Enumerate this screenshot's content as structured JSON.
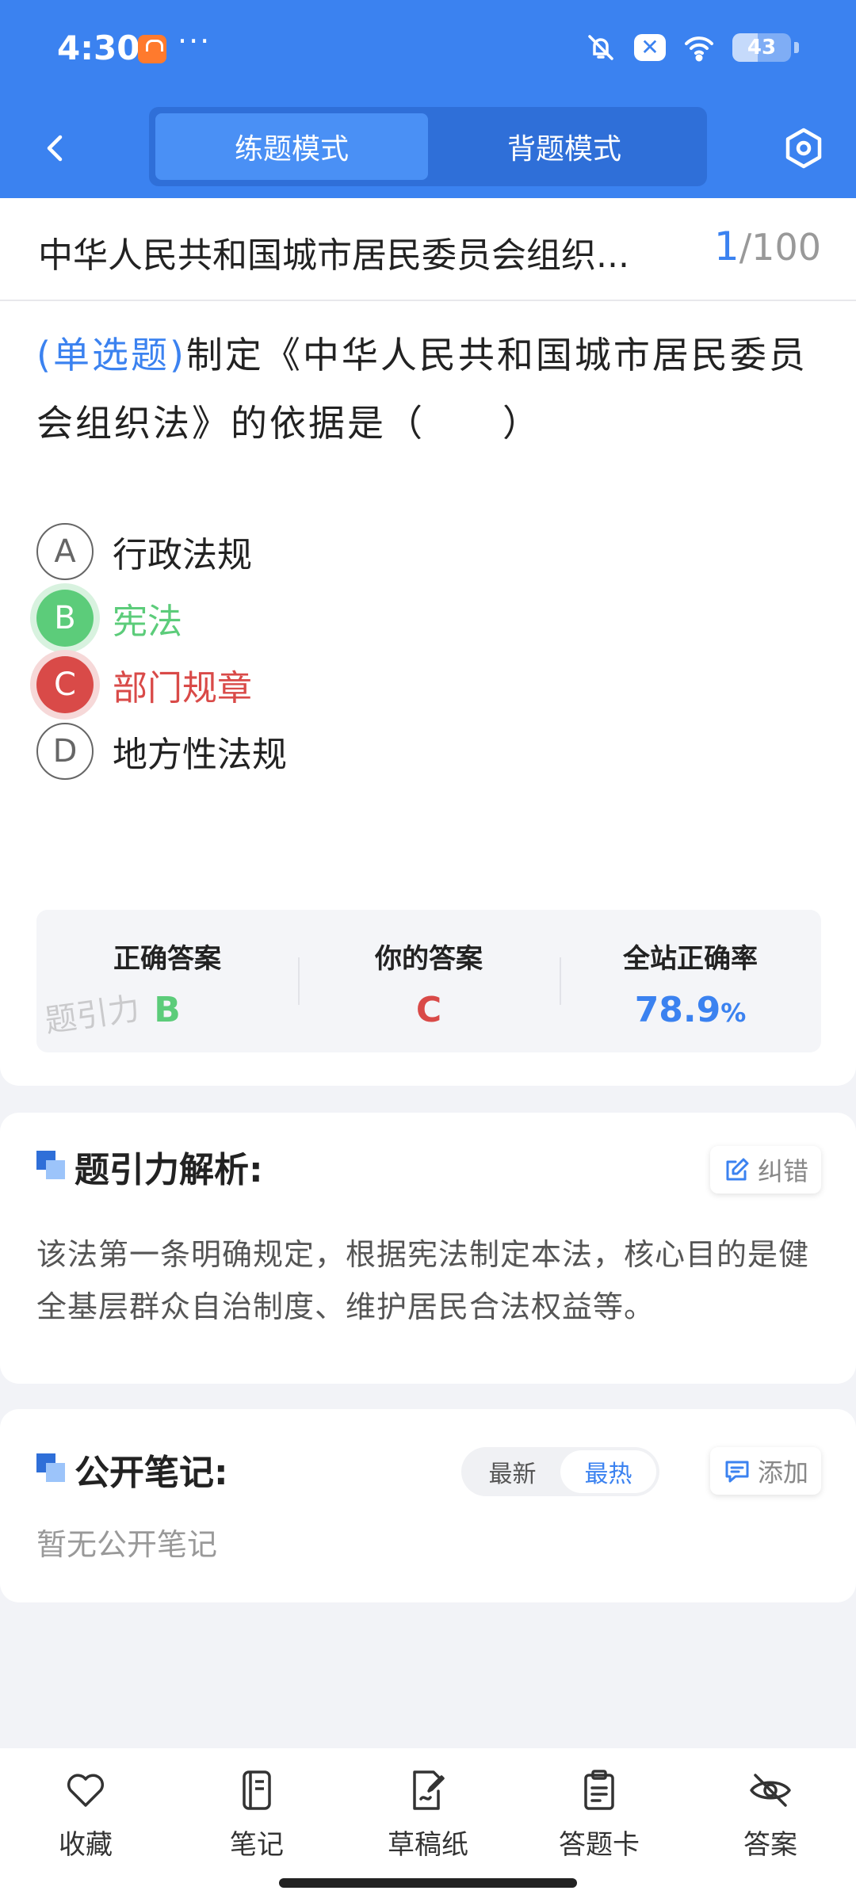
{
  "status_bar": {
    "time": "4:30",
    "dots": "···",
    "battery": "43"
  },
  "nav": {
    "modes": [
      "练题模式",
      "背题模式"
    ],
    "active_mode_index": 0
  },
  "question": {
    "title": "中华人民共和国城市居民委员会组织...",
    "current": "1",
    "total": "/100",
    "type": "(单选题)",
    "stem": "制定《中华人民共和国城市居民委员会组织法》的依据是（　　）",
    "options": [
      {
        "letter": "A",
        "text": "行政法规",
        "state": "normal"
      },
      {
        "letter": "B",
        "text": "宪法",
        "state": "correct"
      },
      {
        "letter": "C",
        "text": "部门规章",
        "state": "wrong"
      },
      {
        "letter": "D",
        "text": "地方性法规",
        "state": "normal"
      }
    ]
  },
  "result": {
    "correct_label": "正确答案",
    "correct_value": "B",
    "yours_label": "你的答案",
    "yours_value": "C",
    "rate_label": "全站正确率",
    "rate_value": "78.9",
    "rate_unit": "%",
    "watermark": "题引力"
  },
  "analysis": {
    "title": "题引力解析:",
    "report_label": "纠错",
    "text": "该法第一条明确规定，根据宪法制定本法，核心目的是健全基层群众自治制度、维护居民合法权益等。"
  },
  "notes": {
    "title": "公开笔记:",
    "sort_options": [
      "最新",
      "最热"
    ],
    "active_sort_index": 1,
    "add_label": "添加",
    "empty_text": "暂无公开笔记"
  },
  "toolbar": {
    "items": [
      {
        "label": "收藏",
        "icon": "heart-icon"
      },
      {
        "label": "笔记",
        "icon": "notebook-icon"
      },
      {
        "label": "草稿纸",
        "icon": "draft-icon"
      },
      {
        "label": "答题卡",
        "icon": "clipboard-icon"
      },
      {
        "label": "答案",
        "icon": "eye-off-icon"
      }
    ]
  },
  "colors": {
    "brand_blue": "#3b82f0",
    "correct_green": "#5ccc7a",
    "wrong_red": "#d94a48"
  }
}
